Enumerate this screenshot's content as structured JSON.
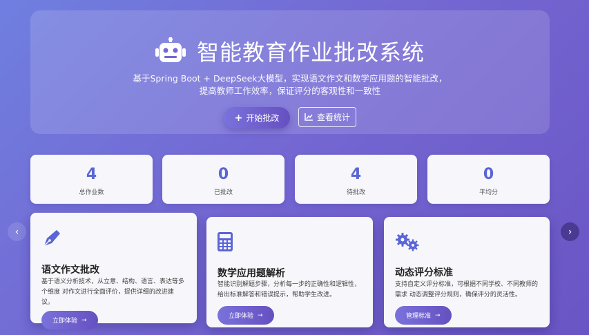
{
  "hero": {
    "title": "智能教育作业批改系统",
    "subtitle_line1": "基于Spring Boot + DeepSeek大模型，实现语文作文和数学应用题的智能批改，",
    "subtitle_line2": "提高教师工作效率，保证评分的客观性和一致性",
    "primary_button": "开始批改",
    "secondary_button": "查看统计"
  },
  "stats": [
    {
      "value": "4",
      "label": "总作业数"
    },
    {
      "value": "0",
      "label": "已批改"
    },
    {
      "value": "4",
      "label": "待批改"
    },
    {
      "value": "0",
      "label": "平均分"
    }
  ],
  "cards": [
    {
      "title": "语文作文批改",
      "desc": "基于语义分析技术，从立意、结构、语言、表达等多个维度 对作文进行全面评价，提供详细的改进建议。",
      "button": "立即体验",
      "icon": "pen-icon"
    },
    {
      "title": "数学应用题解析",
      "desc": "智能识别解题步骤，分析每一步的正确性和逻辑性，给出标准解答和错误提示，帮助学生改进。",
      "button": "立即体验",
      "icon": "calculator-icon"
    },
    {
      "title": "动态评分标准",
      "desc": "支持自定义评分标准，可根据不同学校、不同教师的需求 动态调整评分规则，确保评分的灵活性。",
      "button": "管理标准",
      "icon": "gears-icon"
    }
  ],
  "colors": {
    "accent": "#5a65d6",
    "button_start": "#7a72dc",
    "button_end": "#6650c0"
  }
}
